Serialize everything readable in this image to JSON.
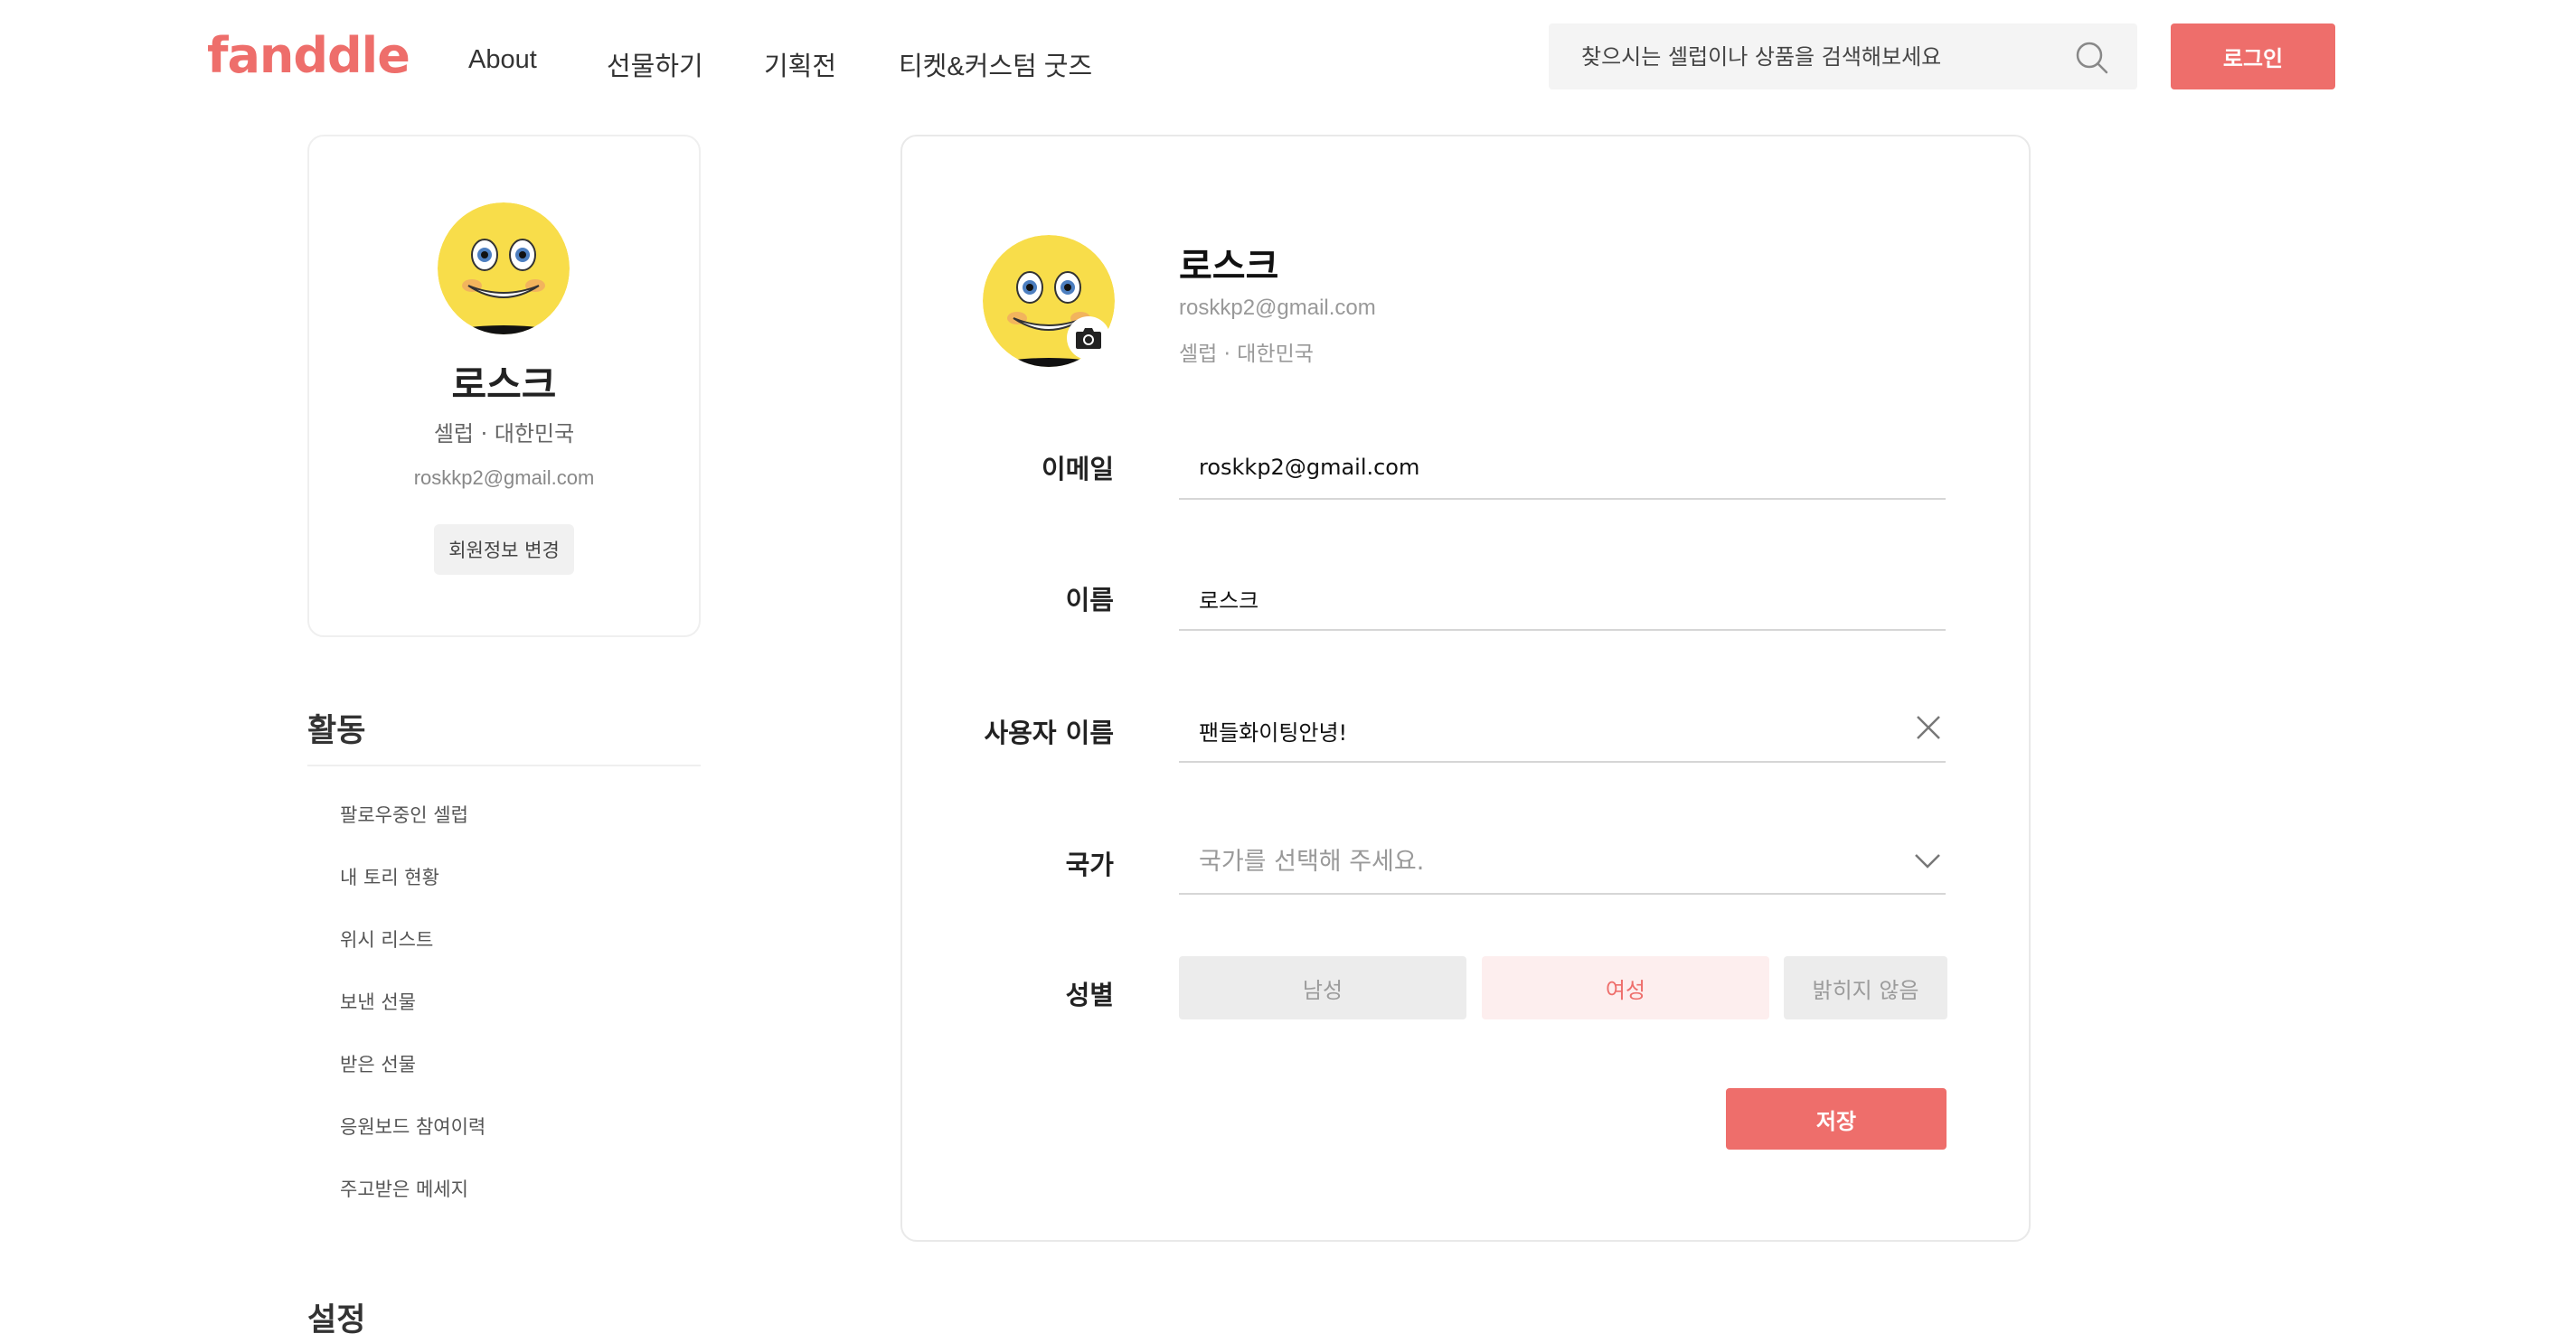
{
  "header": {
    "logo": "fanddle",
    "nav": [
      "About",
      "선물하기",
      "기획전",
      "티켓&커스텀 굿즈"
    ],
    "search_placeholder": "찾으시는 셀럽이나 상품을 검색해보세요",
    "login_label": "로그인"
  },
  "profile_card": {
    "name": "로스크",
    "meta": "셀럽 · 대한민국",
    "email": "roskkp2@gmail.com",
    "edit_label": "회원정보 변경"
  },
  "activity": {
    "title": "활동",
    "items": [
      "팔로우중인 셀럽",
      "내 토리 현황",
      "위시 리스트",
      "보낸 선물",
      "받은 선물",
      "응원보드 참여이력",
      "주고받은 메세지"
    ]
  },
  "settings": {
    "title": "설정"
  },
  "main": {
    "name": "로스크",
    "email": "roskkp2@gmail.com",
    "meta": "셀럽 · 대한민국",
    "fields": {
      "email": {
        "label": "이메일",
        "value": "roskkp2@gmail.com"
      },
      "name": {
        "label": "이름",
        "value": "로스크"
      },
      "username": {
        "label": "사용자 이름",
        "value": "팬들화이팅안녕!"
      },
      "country": {
        "label": "국가",
        "placeholder": "국가를 선택해 주세요."
      },
      "gender": {
        "label": "성별",
        "options": [
          "남성",
          "여성",
          "밝히지 않음"
        ],
        "selected": "여성"
      }
    },
    "save_label": "저장"
  },
  "colors": {
    "accent": "#ee6e6b",
    "accent_light": "#fdeeee",
    "muted_bg": "#ececec"
  },
  "icons": [
    "search-icon",
    "camera-icon",
    "close-icon",
    "chevron-down-icon",
    "smiley-avatar"
  ]
}
